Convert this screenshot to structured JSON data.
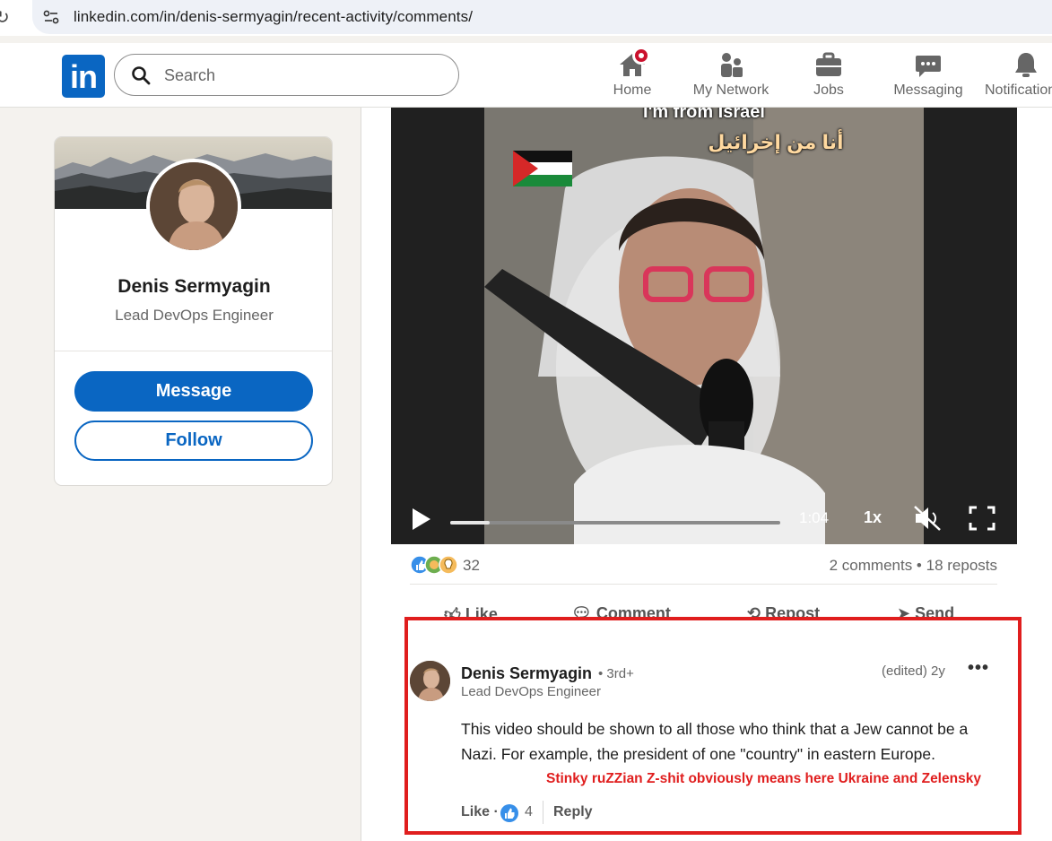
{
  "browser": {
    "url": "linkedin.com/in/denis-sermyagin/recent-activity/comments/"
  },
  "nav": {
    "search_placeholder": "Search",
    "items": [
      {
        "label": "Home",
        "icon": "home-icon"
      },
      {
        "label": "My Network",
        "icon": "people-icon"
      },
      {
        "label": "Jobs",
        "icon": "briefcase-icon"
      },
      {
        "label": "Messaging",
        "icon": "chat-icon"
      },
      {
        "label": "Notifications",
        "icon": "bell-icon"
      }
    ]
  },
  "profile": {
    "name": "Denis Sermyagin",
    "title": "Lead DevOps Engineer",
    "message_label": "Message",
    "follow_label": "Follow"
  },
  "video": {
    "overlay_top": "I'm from Israel",
    "overlay_arabic": "أنا من إخرائيل",
    "time": "1:04",
    "speed": "1x",
    "progress": 0.12
  },
  "post": {
    "reaction_count": "32",
    "comments_reposts": "2 comments • 18 reposts",
    "actions": [
      "Like",
      "Comment",
      "Repost",
      "Send"
    ]
  },
  "comment": {
    "author": "Denis Sermyagin",
    "degree": "• 3rd+",
    "headline": "Lead DevOps Engineer",
    "time": "(edited) 2y",
    "more": "•••",
    "text": "This video should be shown to all those who think that a Jew cannot be a Nazi. For example, the president of one \"country\" in eastern Europe.",
    "like_label": "Like ·",
    "like_count": "4",
    "reply_label": "Reply"
  },
  "annotation": {
    "text": "Stinky ruZZian Z-shit obviously means here Ukraine and Zelensky",
    "color": "#e01e1e"
  },
  "colors": {
    "brand": "#0a66c2",
    "notification_badge": "#cb112d"
  }
}
